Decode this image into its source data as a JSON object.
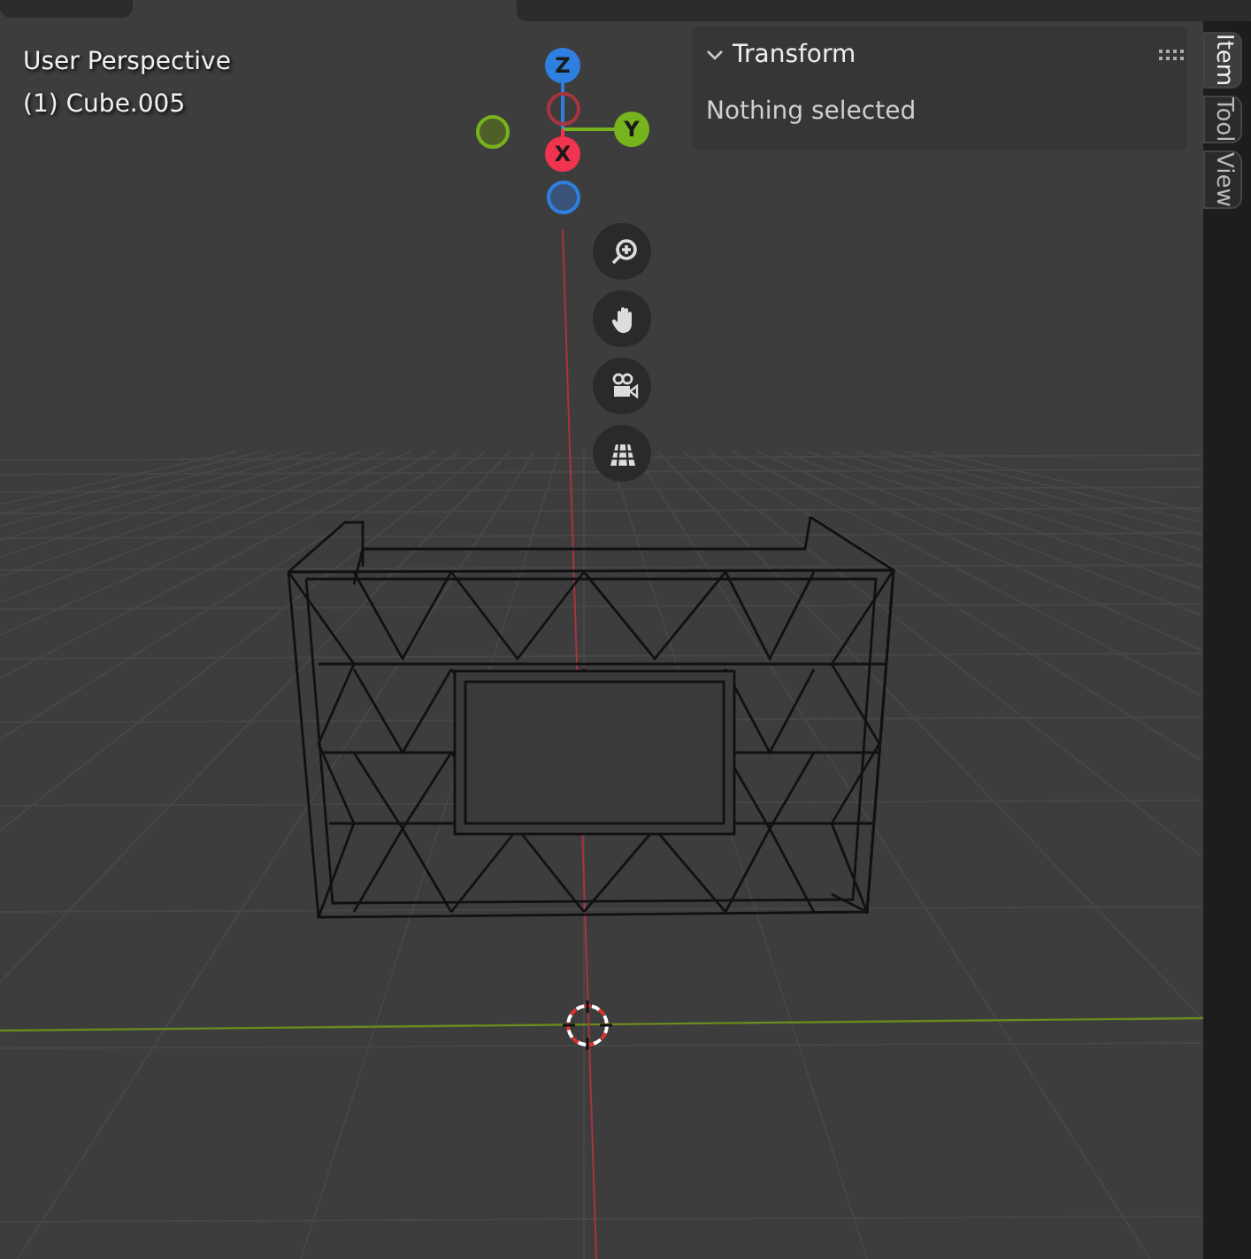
{
  "viewport": {
    "view_name": "User Perspective",
    "object_name": "(1) Cube.005"
  },
  "gizmo": {
    "axes": [
      {
        "label": "Z",
        "kind": "z"
      },
      {
        "label": "Y",
        "kind": "y"
      },
      {
        "label": "X",
        "kind": "x"
      }
    ]
  },
  "nav_buttons": [
    {
      "kind": "zoom"
    },
    {
      "kind": "pan"
    },
    {
      "kind": "camera"
    },
    {
      "kind": "ortho"
    }
  ],
  "sidebar": {
    "panel": {
      "title": "Transform",
      "expanded": true,
      "message": "Nothing selected"
    },
    "tabs": [
      {
        "label": "Item",
        "selected": true
      },
      {
        "label": "Tool",
        "selected": false
      },
      {
        "label": "View",
        "selected": false
      }
    ]
  }
}
